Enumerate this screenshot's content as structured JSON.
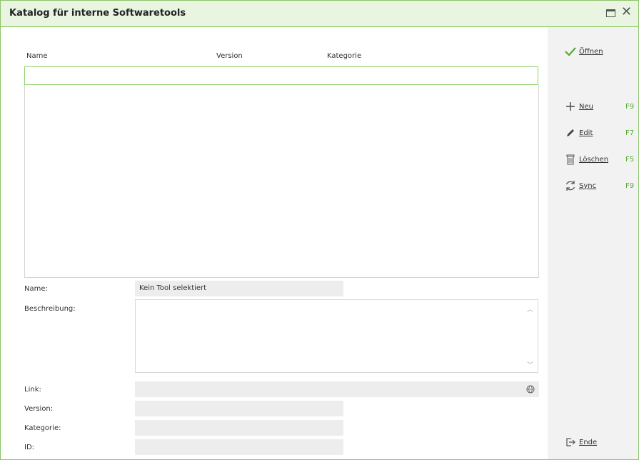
{
  "window": {
    "title": "Katalog für interne Softwaretools"
  },
  "list": {
    "columns": [
      "Name",
      "Version",
      "Kategorie"
    ]
  },
  "details": {
    "name_label": "Name:",
    "name_value": "Kein Tool selektiert",
    "description_label": "Beschreibung:",
    "link_label": "Link:",
    "version_label": "Version:",
    "category_label": "Kategorie:",
    "id_label": "ID:"
  },
  "actions": {
    "open": "Öffnen",
    "new": "Neu",
    "new_key": "F9",
    "edit": "Edit",
    "edit_key": "F7",
    "delete": "Löschen",
    "delete_key": "F5",
    "sync": "Sync",
    "sync_key": "F9",
    "end": "Ende"
  },
  "colors": {
    "accent": "#74c24a",
    "titlebar": "#e9f4e1",
    "shortcut": "#5aa832"
  }
}
